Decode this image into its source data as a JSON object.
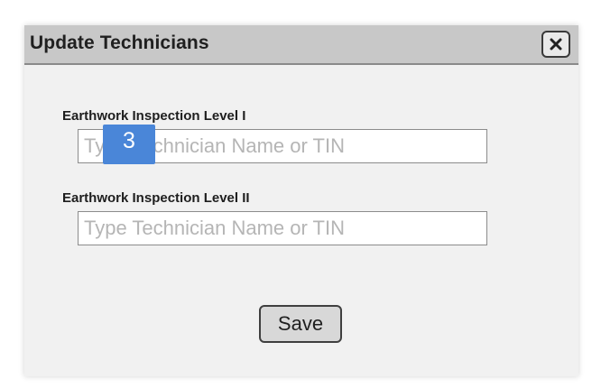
{
  "dialog": {
    "title": "Update Technicians",
    "close_icon": "close-icon"
  },
  "fields": [
    {
      "label": "Earthwork Inspection Level I",
      "value": "",
      "placeholder": "Type Technician Name or TIN"
    },
    {
      "label": "Earthwork Inspection Level II",
      "value": "",
      "placeholder": "Type Technician Name or TIN"
    }
  ],
  "annotation": {
    "badge_number": "3",
    "badge_color": "#4a86d8"
  },
  "actions": {
    "save_label": "Save"
  }
}
